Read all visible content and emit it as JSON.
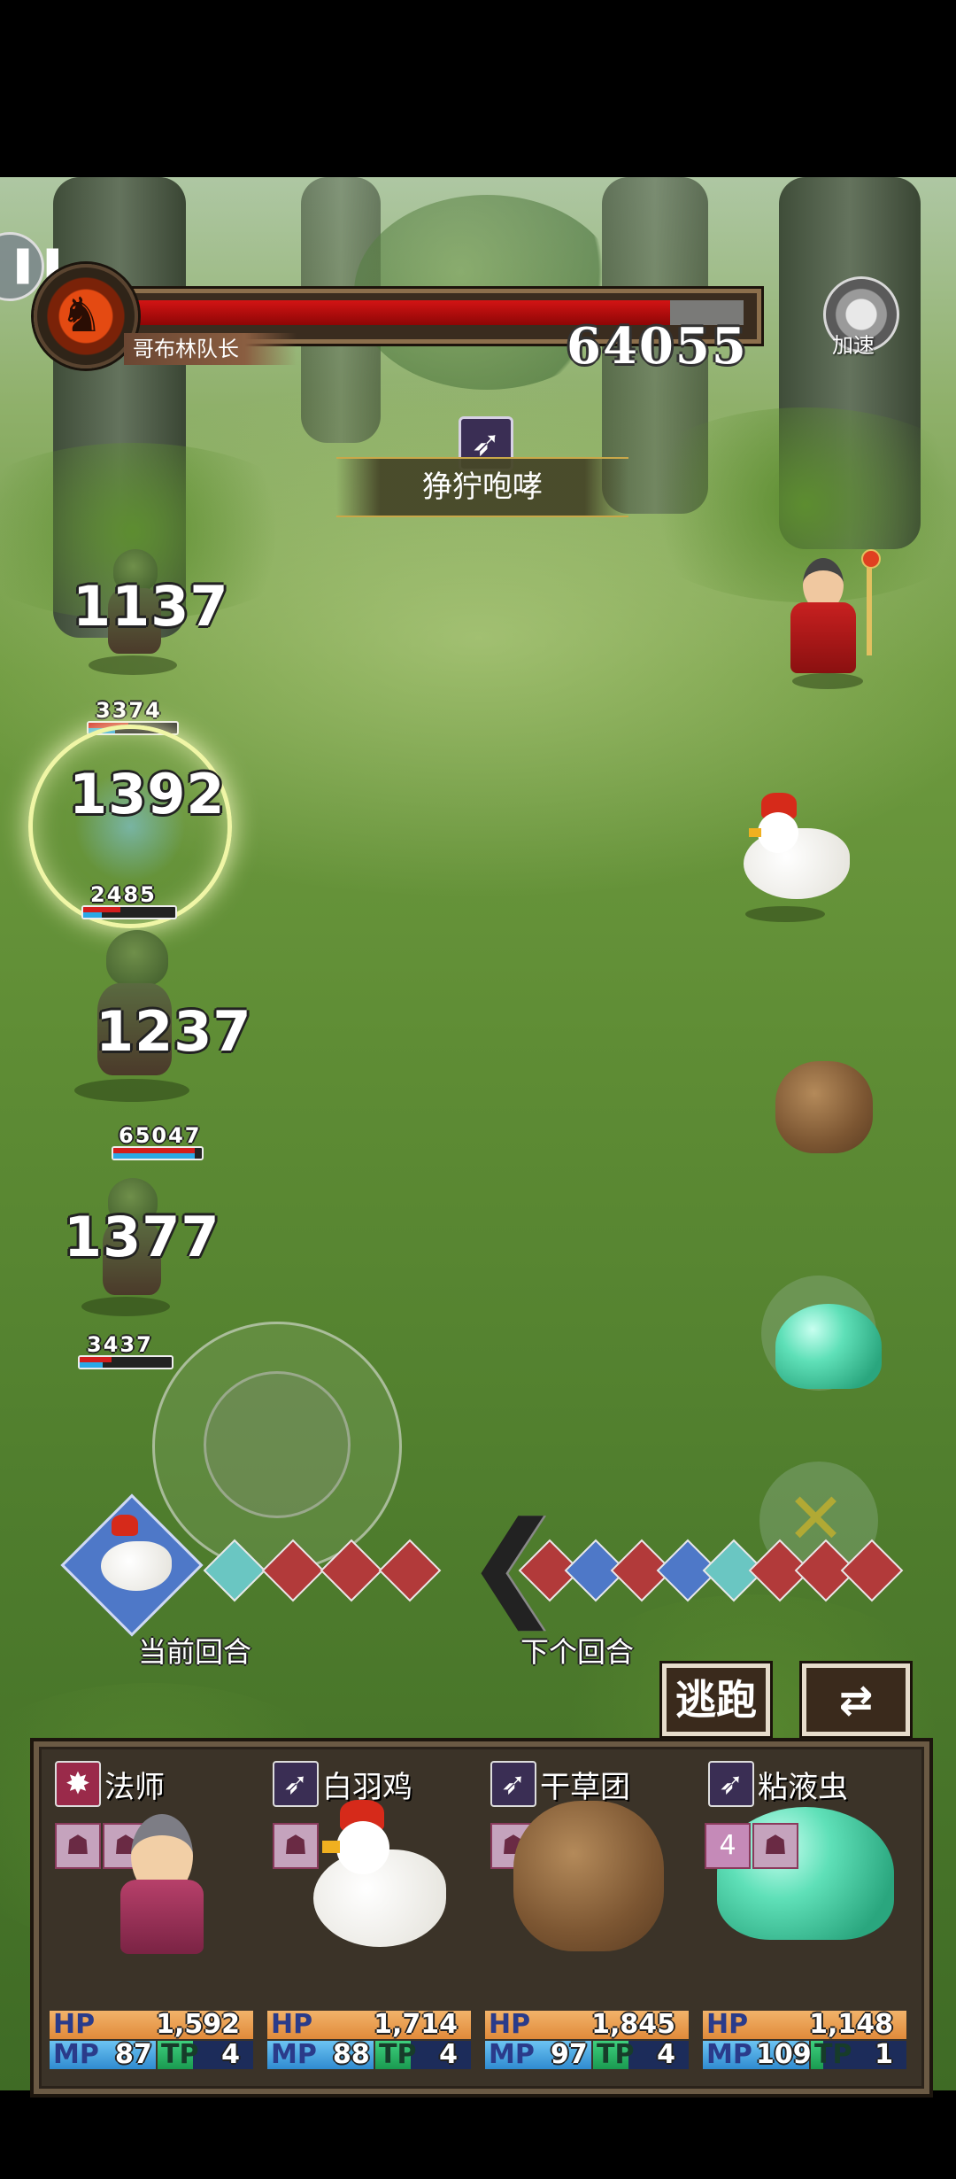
{
  "boss": {
    "name": "哥布林队长",
    "hp_value": "64055",
    "hp_fraction": 0.88,
    "icon": "dragon-head-icon"
  },
  "controls": {
    "speed_label": "加速",
    "pause_icon": "pause-icon",
    "flee_label": "逃跑",
    "switch_icon": "switch-party-icon"
  },
  "skill": {
    "name": "狰狞咆哮",
    "icon": "claw-slash-icon"
  },
  "enemies": [
    {
      "damage": "1137",
      "hp": ""
    },
    {
      "damage": "1392",
      "hp": "3374"
    },
    {
      "damage": "1237",
      "hp": "2485"
    },
    {
      "damage": "1377",
      "hp": "65047"
    },
    {
      "damage": "",
      "hp": "3437"
    }
  ],
  "turn_order": {
    "current_label": "当前回合",
    "next_label": "下个回合"
  },
  "party": [
    {
      "name": "法师",
      "hp": "1,592",
      "mp": "87",
      "tp": "4",
      "status_count": 2,
      "skill_icon": "burst-icon",
      "skill_color": "#9a2a4a"
    },
    {
      "name": "白羽鸡",
      "hp": "1,714",
      "mp": "88",
      "tp": "4",
      "status_count": 1,
      "skill_icon": "claw-slash-icon",
      "skill_color": "#3a2e54"
    },
    {
      "name": "干草团",
      "hp": "1,845",
      "mp": "97",
      "tp": "4",
      "status_count": 1,
      "skill_icon": "claw-slash-icon",
      "skill_color": "#3a2e54"
    },
    {
      "name": "粘液虫",
      "hp": "1,148",
      "mp": "109",
      "tp": "1",
      "status_count": 2,
      "skill_icon": "claw-slash-icon",
      "skill_color": "#3a2e54",
      "status_badge": "4"
    }
  ],
  "bar_labels": {
    "hp": "HP",
    "mp": "MP",
    "tp": "TP"
  }
}
